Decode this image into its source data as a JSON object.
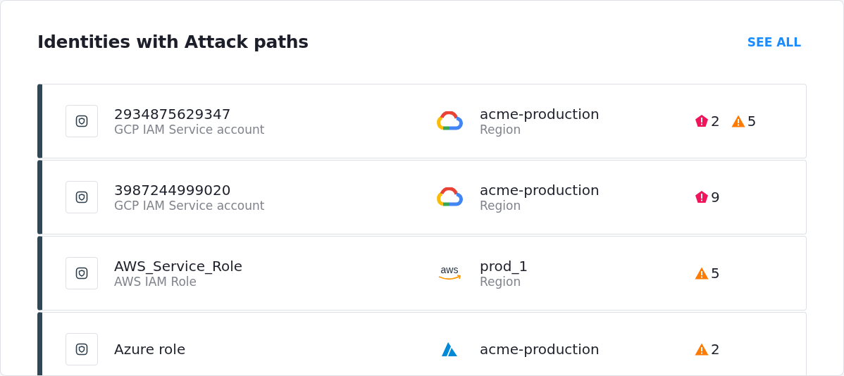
{
  "title": "Identities with Attack paths",
  "see_all": "SEE ALL",
  "rows": [
    {
      "name": "2934875629347",
      "type": "GCP IAM Service account",
      "kind": "gcp",
      "location": "acme-production",
      "location_type": "Region",
      "alerts": [
        {
          "kind": "critical",
          "count": "2"
        },
        {
          "kind": "high",
          "count": "5"
        }
      ]
    },
    {
      "name": "3987244999020",
      "type": "GCP IAM Service account",
      "kind": "gcp",
      "location": "acme-production",
      "location_type": "Region",
      "alerts": [
        {
          "kind": "critical",
          "count": "9"
        }
      ]
    },
    {
      "name": "AWS_Service_Role",
      "type": "AWS IAM Role",
      "kind": "aws",
      "location": "prod_1",
      "location_type": "Region",
      "alerts": [
        {
          "kind": "high",
          "count": "5"
        }
      ]
    },
    {
      "name": "Azure role",
      "kind": "azure",
      "location": "acme-production",
      "alerts": [
        {
          "kind": "high",
          "count": "2"
        }
      ]
    }
  ]
}
